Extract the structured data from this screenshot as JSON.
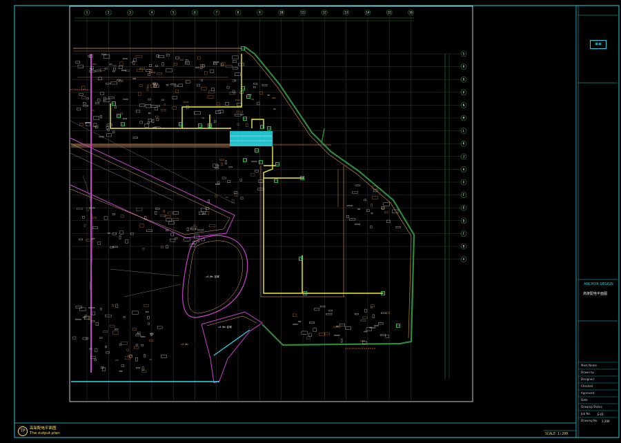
{
  "drawing": {
    "title": "高架配电平面图",
    "subtitle": "The output plan",
    "scale": "SCALE 1:200",
    "logo_mark": "TP"
  },
  "title_block": {
    "brand": "ANCHOR DESIGN",
    "project_title": "高架配电平面图",
    "rows": [
      "Mark Name",
      "Drawn by",
      "Designed",
      "Checked",
      "Approved",
      "Date",
      "Drawing Status",
      "Job No.",
      "Drawing No."
    ],
    "sheet_no": "E-01",
    "revision": "1:200"
  },
  "grid": {
    "top_labels": [
      "1",
      "2",
      "3",
      "4",
      "5",
      "6",
      "7",
      "8",
      "9",
      "10",
      "11",
      "12",
      "13",
      "14",
      "15",
      "16"
    ],
    "right_labels": [
      "S",
      "R",
      "Q",
      "P",
      "N",
      "M",
      "L",
      "K",
      "J",
      "H",
      "G",
      "F",
      "E",
      "D",
      "C",
      "B",
      "A"
    ]
  },
  "annotations": {
    "area_a": "+4.8m 区域",
    "area_b": "+4.8m 区域",
    "area_c": "+4.8m"
  },
  "colors": {
    "frame": "#1fd0e0",
    "grid": "#5a5a5a",
    "wall": "#b07840",
    "cable": "#f4f02a",
    "landscape": "#2e8b3a",
    "ramp": "#d040d0",
    "highlight": "#28e0f0",
    "paper": "#ffffff"
  }
}
